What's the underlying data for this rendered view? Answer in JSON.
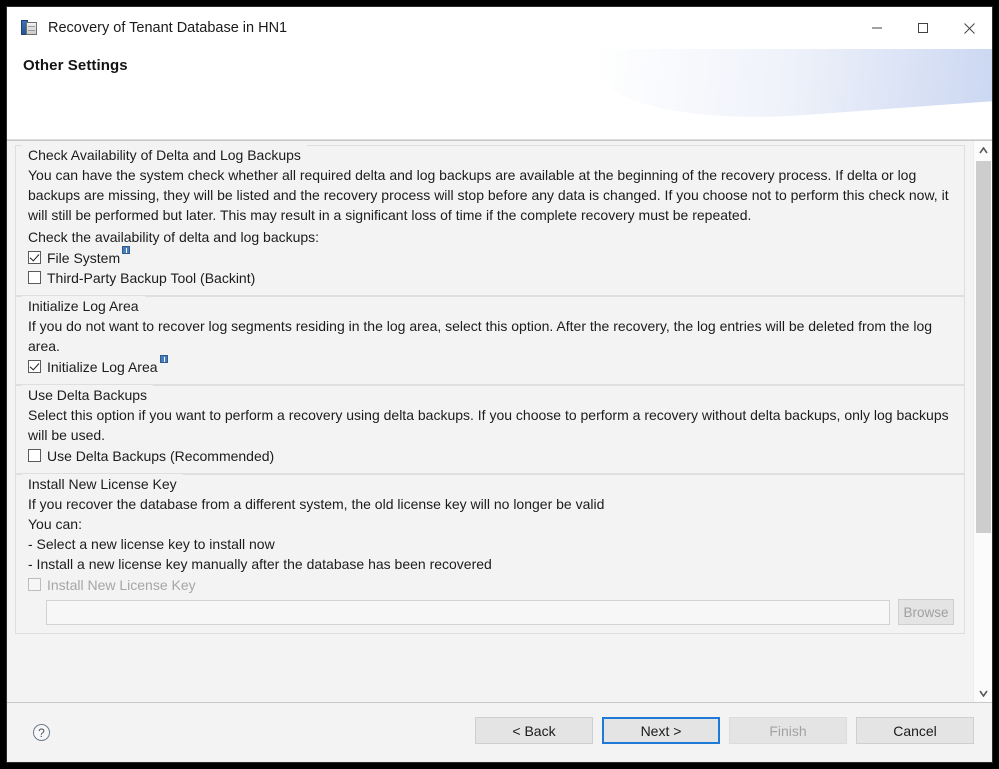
{
  "window": {
    "title": "Recovery of Tenant Database in HN1",
    "icon": "database-icon",
    "controls": {
      "minimize": "minimize-icon",
      "maximize": "maximize-icon",
      "close": "close-icon"
    }
  },
  "header": {
    "title": "Other Settings"
  },
  "sections": [
    {
      "legend": "Check Availability of Delta and Log Backups",
      "paragraph": "You can have the system check whether all required delta and log backups are available at the beginning of the recovery process. If delta or log backups are missing, they will be listed and the recovery process will stop before any data is changed. If you choose not to perform this check now, it will still be performed but later. This may result in a significant loss of time if the complete recovery must be repeated.",
      "sub_label": "Check the availability of delta and log backups:",
      "checkboxes": [
        {
          "label": "File System",
          "checked": true,
          "disabled": false,
          "badge": true
        },
        {
          "label": "Third-Party Backup Tool (Backint)",
          "checked": false,
          "disabled": false,
          "badge": false
        }
      ]
    },
    {
      "legend": "Initialize Log Area",
      "paragraph": "If you do not want to recover log segments residing in the log area, select this option. After the recovery, the log entries will be deleted from the log area.",
      "checkboxes": [
        {
          "label": "Initialize Log Area",
          "checked": true,
          "disabled": false,
          "badge": true
        }
      ]
    },
    {
      "legend": "Use Delta Backups",
      "paragraph": "Select this option if you want to perform a recovery using delta backups. If you choose to perform a recovery without delta backups, only log backups will be used.",
      "checkboxes": [
        {
          "label": "Use Delta Backups (Recommended)",
          "checked": false,
          "disabled": false,
          "badge": false
        }
      ]
    },
    {
      "legend": "Install New License Key",
      "paragraph": "If you recover the database from a different system, the old license key will no longer be valid",
      "lines": [
        "You can:",
        "- Select a new license key to install now",
        "- Install a new license key manually after the database has been recovered"
      ],
      "checkboxes": [
        {
          "label": "Install New License Key",
          "checked": false,
          "disabled": true,
          "badge": false
        }
      ],
      "field": {
        "value": "",
        "placeholder": "",
        "browse_label": "Browse",
        "disabled": true
      }
    }
  ],
  "scrollbar": {
    "up_arrow": "scroll-up-arrow-icon",
    "down_arrow": "scroll-down-arrow-icon"
  },
  "footer": {
    "help": "?",
    "buttons": [
      {
        "label": "< Back",
        "state": "normal"
      },
      {
        "label": "Next >",
        "state": "focused"
      },
      {
        "label": "Finish",
        "state": "disabled"
      },
      {
        "label": "Cancel",
        "state": "normal"
      }
    ]
  }
}
